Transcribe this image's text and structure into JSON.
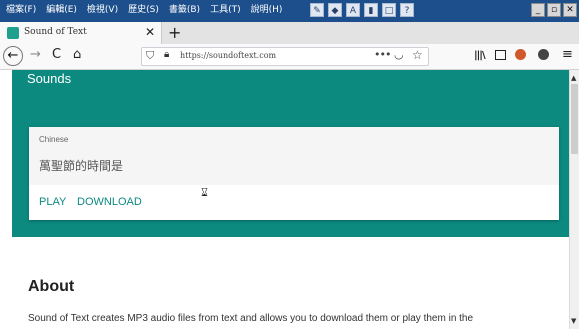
{
  "menu_bar": {
    "items": [
      "檔案(F)",
      "編輯(E)",
      "檢視(V)",
      "歷史(S)",
      "書籤(B)",
      "工具(T)",
      "說明(H)"
    ],
    "window_buttons": [
      "_",
      "▫",
      "✕"
    ]
  },
  "tab": {
    "title": "Sound of Text",
    "close_label": "✕",
    "new_tab_label": "+"
  },
  "nav": {
    "url": "https://soundoftext.com",
    "back": "←",
    "forward": "→",
    "reload": "C",
    "home": "⌂",
    "more": "•••",
    "star": "☆"
  },
  "page": {
    "section_title": "Sounds",
    "card": {
      "language_label": "Chinese",
      "phrase": "萬聖節的時間是",
      "play_label": "PLAY",
      "download_label": "DOWNLOAD"
    },
    "about_title": "About",
    "about_text": "Sound of Text creates MP3 audio files from text and allows you to download them or play them in the"
  },
  "colors": {
    "accent": "#0c8a80",
    "menubar": "#1c4f8c"
  },
  "icons": [
    "search-icon",
    "shield-icon",
    "lock-icon",
    "star-icon",
    "hourglass-icon"
  ]
}
